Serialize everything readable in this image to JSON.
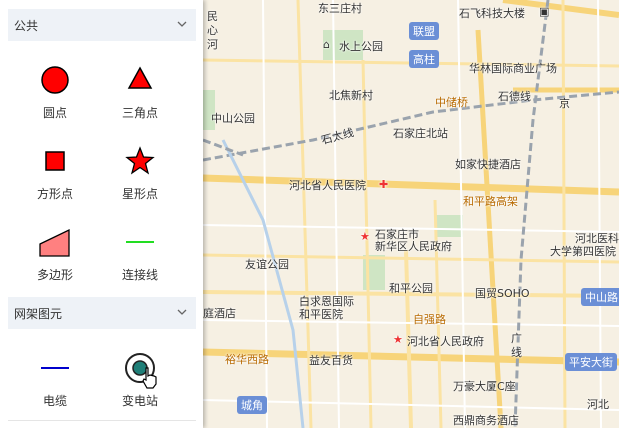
{
  "sidebar": {
    "sections": [
      {
        "title": "公共",
        "items": [
          {
            "label": "圆点",
            "icon": "red-circle-icon"
          },
          {
            "label": "三角点",
            "icon": "red-triangle-icon"
          },
          {
            "label": "方形点",
            "icon": "red-square-icon"
          },
          {
            "label": "星形点",
            "icon": "red-star-icon"
          },
          {
            "label": "多边形",
            "icon": "polygon-icon"
          },
          {
            "label": "连接线",
            "icon": "green-line-icon"
          }
        ]
      },
      {
        "title": "网架图元",
        "items": [
          {
            "label": "电缆",
            "icon": "blue-line-icon"
          },
          {
            "label": "变电站",
            "icon": "substation-icon"
          }
        ]
      }
    ]
  },
  "map": {
    "labels": {
      "l1": "东三庄村",
      "l2": "联盟",
      "l3": "石飞科技大楼",
      "l4": "水上公园",
      "l5": "高柱",
      "l6": "华林国际商业广场",
      "l7": "北焦新村",
      "l8": "中储桥",
      "l9": "石德线",
      "l10": "中山公园",
      "l11": "石太线",
      "l12": "石家庄北站",
      "l13": "如家快捷酒店",
      "l14": "河北省人民医院",
      "l15": "和平路高架",
      "l16": "石家庄市",
      "l17": "新华区人民政府",
      "l18": "友谊公园",
      "l19": "和平公园",
      "l20": "国贸SOHO",
      "l21": "白求恩国际",
      "l22": "和平医院",
      "l23": "自强路",
      "l24": "河北省人民政府",
      "l25": "裕华西路",
      "l26": "益友百货",
      "l27": "万豪大厦C座",
      "l28": "城角",
      "l29": "西鼎商务酒店",
      "l30": "中山路",
      "l31": "平安大街",
      "l32": "河北医科",
      "l33": "大学第四医院",
      "l34": "庭酒店",
      "l35": "民",
      "l36": "心",
      "l37": "河",
      "l38": "京",
      "l39": "广",
      "l40": "线",
      "l41": "河北"
    }
  }
}
